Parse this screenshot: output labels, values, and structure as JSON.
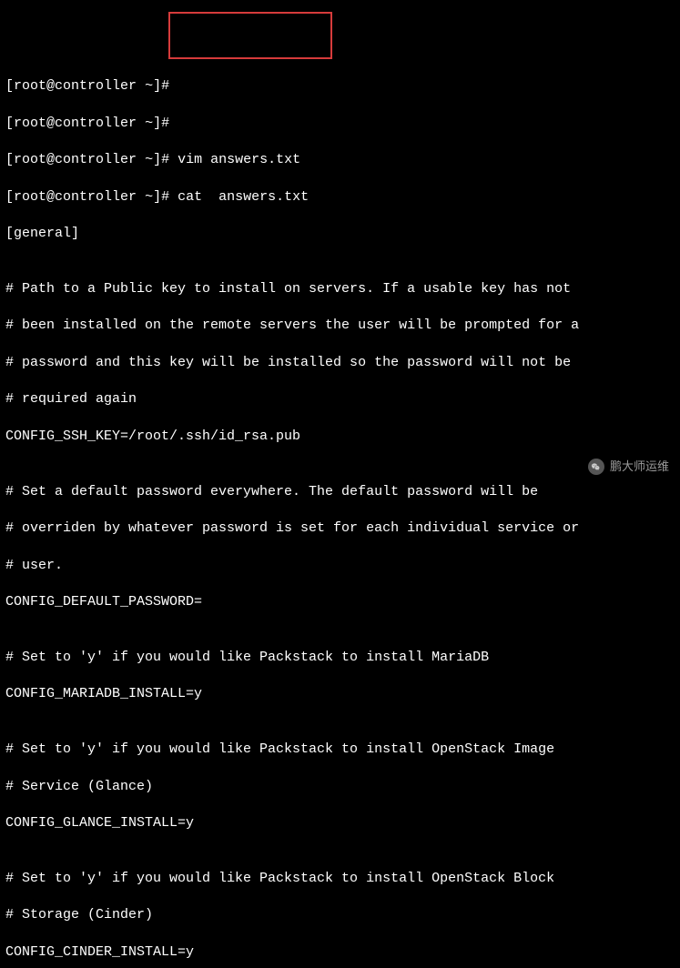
{
  "prompt": {
    "user": "root",
    "host": "controller",
    "path": "~",
    "symbol": "#"
  },
  "prompt_lines": [
    {
      "cmd": ""
    },
    {
      "cmd": ""
    },
    {
      "cmd": "vim answers.txt"
    },
    {
      "cmd": "cat  answers.txt"
    }
  ],
  "file_output": [
    "[general]",
    "",
    "# Path to a Public key to install on servers. If a usable key has not",
    "# been installed on the remote servers the user will be prompted for a",
    "# password and this key will be installed so the password will not be",
    "# required again",
    "CONFIG_SSH_KEY=/root/.ssh/id_rsa.pub",
    "",
    "# Set a default password everywhere. The default password will be",
    "# overriden by whatever password is set for each individual service or",
    "# user.",
    "CONFIG_DEFAULT_PASSWORD=",
    "",
    "# Set to 'y' if you would like Packstack to install MariaDB",
    "CONFIG_MARIADB_INSTALL=y",
    "",
    "# Set to 'y' if you would like Packstack to install OpenStack Image",
    "# Service (Glance)",
    "CONFIG_GLANCE_INSTALL=y",
    "",
    "# Set to 'y' if you would like Packstack to install OpenStack Block",
    "# Storage (Cinder)",
    "CONFIG_CINDER_INSTALL=y"
  ],
  "watermark": {
    "text": "鹏大师运维"
  }
}
